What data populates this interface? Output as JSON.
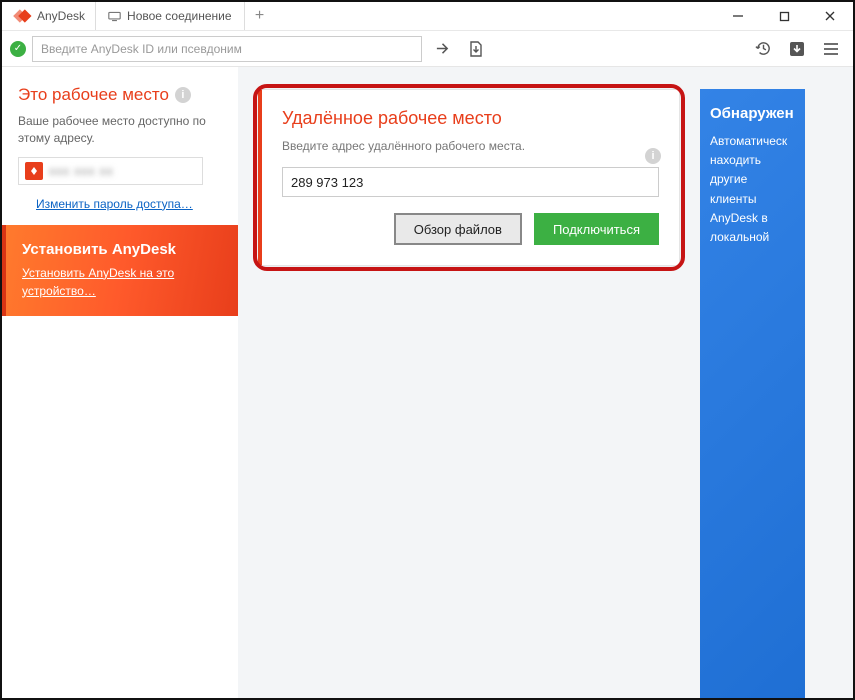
{
  "window": {
    "app_name": "AnyDesk",
    "tab_new": "Новое соединение",
    "plus": "+"
  },
  "toolbar": {
    "address_placeholder": "Введите AnyDesk ID или псевдоним",
    "arrow_title": "Перейти",
    "file_title": "Файл"
  },
  "sidebar": {
    "local": {
      "title": "Это рабочее место",
      "desc": "Ваше рабочее место доступно по этому адресу.",
      "id_masked": "xxx xxx xx",
      "change_pwd": "Изменить пароль доступа…"
    },
    "install": {
      "title": "Установить AnyDesk",
      "link": "Установить AnyDesk на это устройство…"
    }
  },
  "remote": {
    "title": "Удалённое рабочее место",
    "hint": "Введите адрес удалённого рабочего места.",
    "value": "289 973 123",
    "browse": "Обзор файлов",
    "connect": "Подключиться"
  },
  "discover": {
    "title": "Обнаружен",
    "desc": "Автоматическ находить другие клиенты AnyDesk в локальной"
  }
}
